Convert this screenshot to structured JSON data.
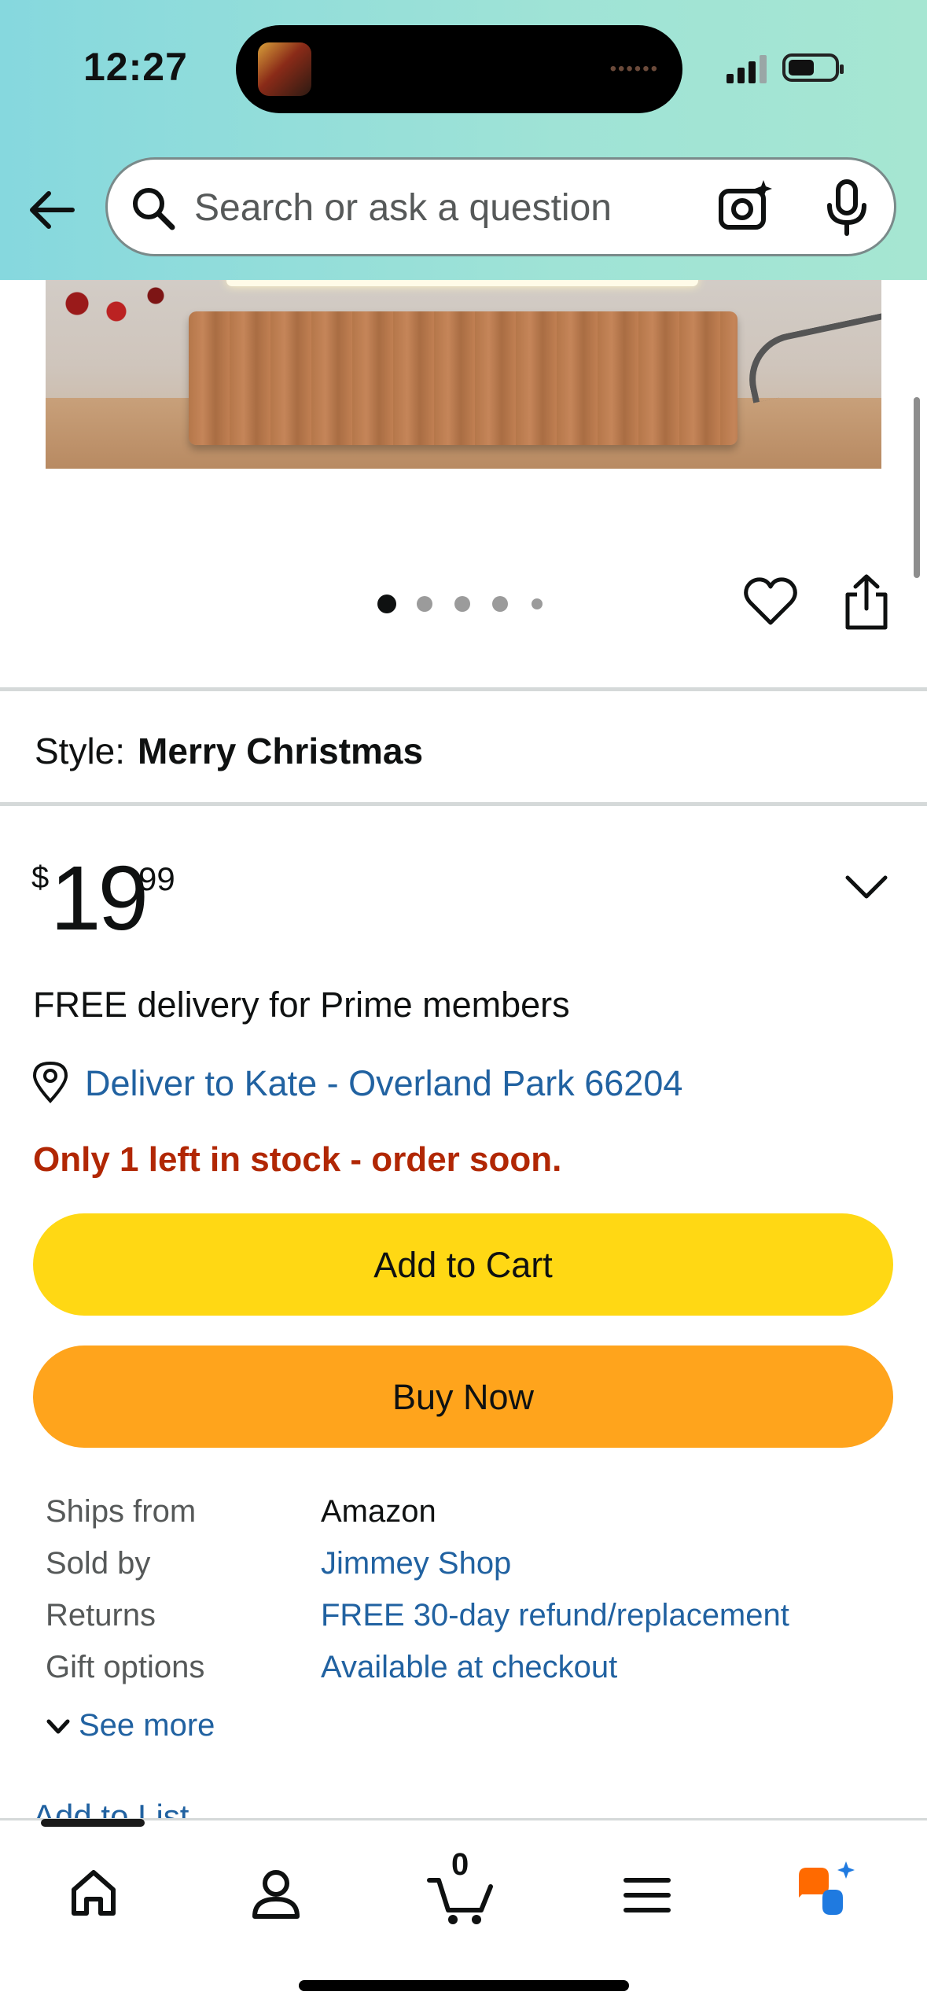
{
  "status_bar": {
    "time": "12:27"
  },
  "search": {
    "placeholder": "Search or ask a question"
  },
  "image_carousel": {
    "total_dots": 5,
    "active_index": 0
  },
  "style": {
    "label": "Style:",
    "value": "Merry Christmas"
  },
  "price": {
    "currency": "$",
    "whole": "19",
    "fraction": "99"
  },
  "delivery": {
    "text": "FREE delivery for Prime members",
    "location": "Deliver to Kate - Overland Park 66204"
  },
  "stock": {
    "text": "Only 1 left in stock - order soon."
  },
  "actions": {
    "add_to_cart": "Add to Cart",
    "buy_now": "Buy Now"
  },
  "details": [
    {
      "label": "Ships from",
      "value": "Amazon",
      "link": false
    },
    {
      "label": "Sold by",
      "value": "Jimmey Shop",
      "link": true
    },
    {
      "label": "Returns",
      "value": "FREE 30-day refund/replacement",
      "link": true
    },
    {
      "label": "Gift options",
      "value": "Available at checkout",
      "link": true
    }
  ],
  "see_more": "See more",
  "add_to_list": "Add to List",
  "bottom_nav": {
    "cart_count": "0"
  },
  "colors": {
    "accent_link": "#2162a1",
    "stock_warning": "#b12704",
    "add_to_cart": "#ffd814",
    "buy_now": "#ffa41c"
  }
}
